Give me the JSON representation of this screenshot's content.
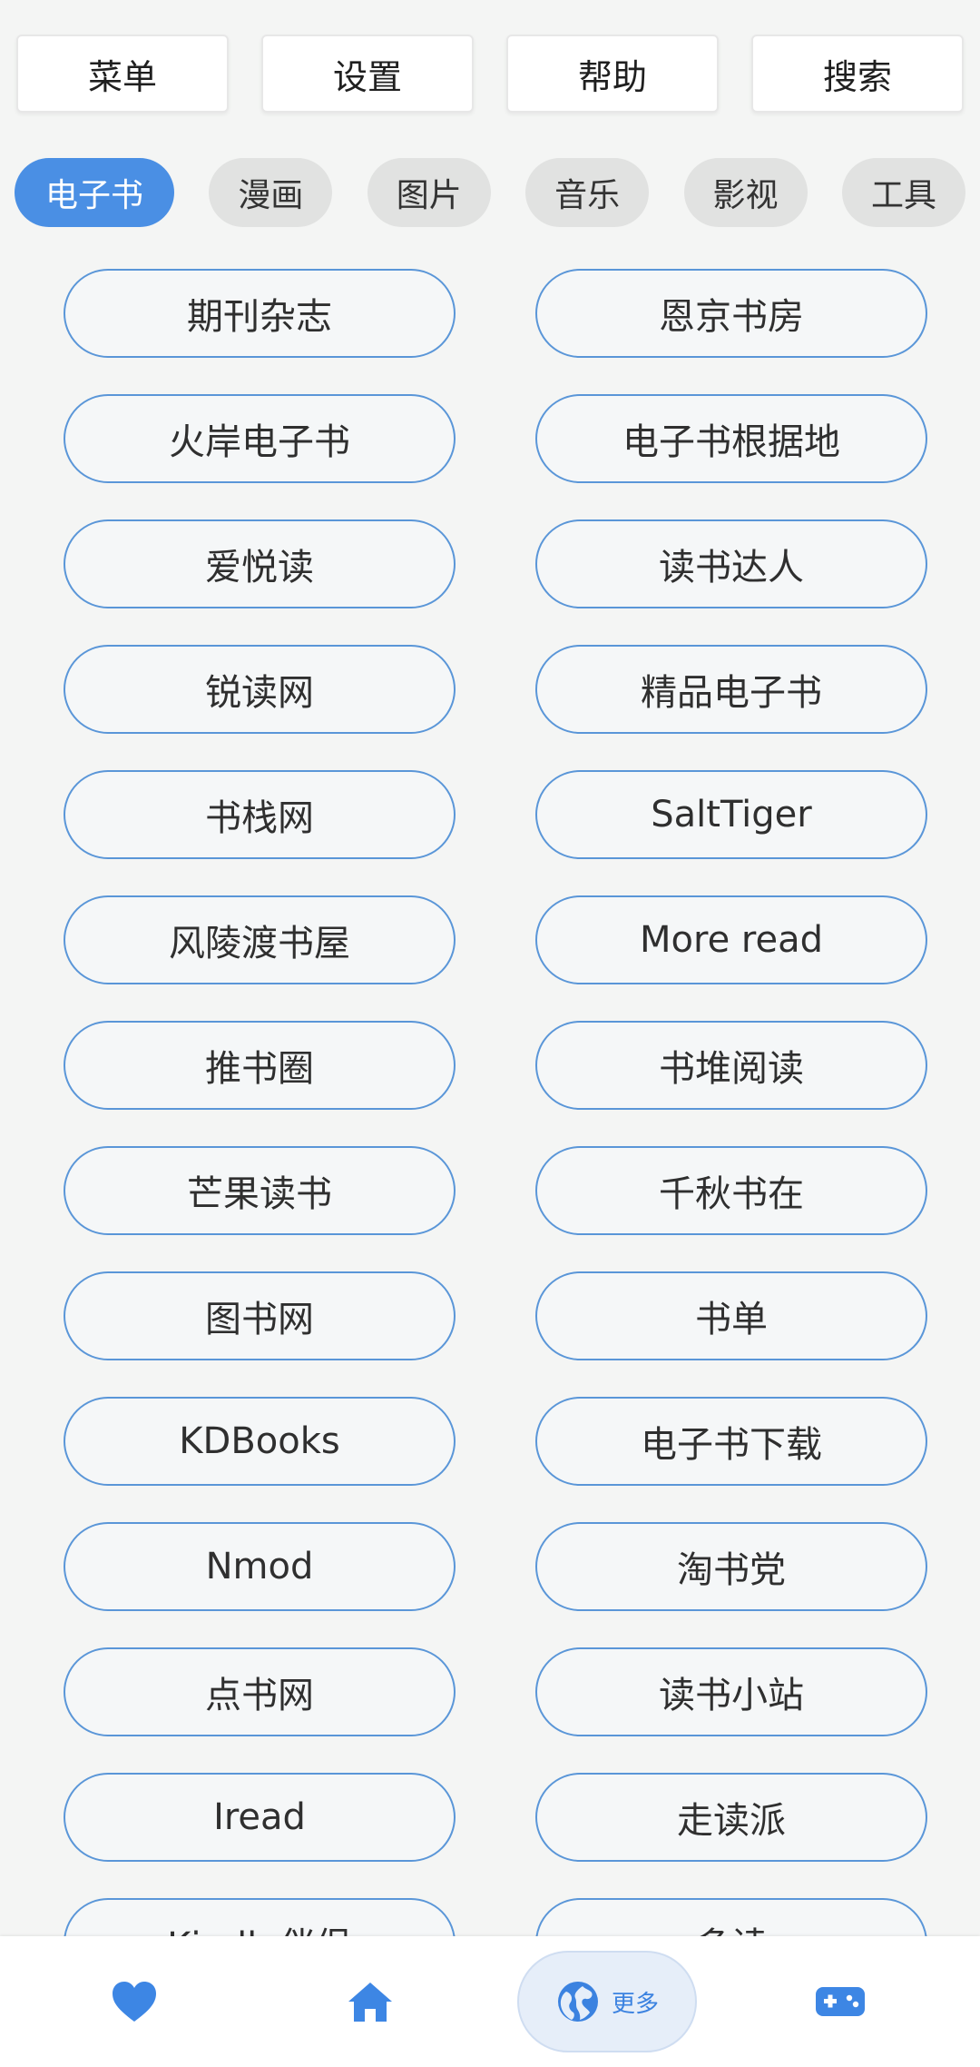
{
  "top_buttons": [
    "菜单",
    "设置",
    "帮助",
    "搜索"
  ],
  "tabs": [
    {
      "label": "电子书",
      "active": true
    },
    {
      "label": "漫画",
      "active": false
    },
    {
      "label": "图片",
      "active": false
    },
    {
      "label": "音乐",
      "active": false
    },
    {
      "label": "影视",
      "active": false
    },
    {
      "label": "工具",
      "active": false
    }
  ],
  "sites": [
    "期刊杂志",
    "恩京书房",
    "火岸电子书",
    "电子书根据地",
    "爱悦读",
    "读书达人",
    "锐读网",
    "精品电子书",
    "书栈网",
    "SaltTiger",
    "风陵渡书屋",
    "More read",
    "推书圈",
    "书堆阅读",
    "芒果读书",
    "千秋书在",
    "图书网",
    "书单",
    "KDBooks",
    "电子书下载",
    "Nmod",
    "淘书党",
    "点书网",
    "读书小站",
    "Iread",
    "走读派",
    "Kindle伴侣",
    "多读"
  ],
  "bottom_nav": {
    "favorites_icon": "heart-icon",
    "home_icon": "home-icon",
    "more_icon": "globe-icon",
    "more_label": "更多",
    "games_icon": "gamepad-icon"
  },
  "colors": {
    "accent": "#4a8fe4",
    "pill_border": "#5a96d8",
    "background": "#f4f5f4",
    "tab_inactive": "#e1e2e1"
  }
}
